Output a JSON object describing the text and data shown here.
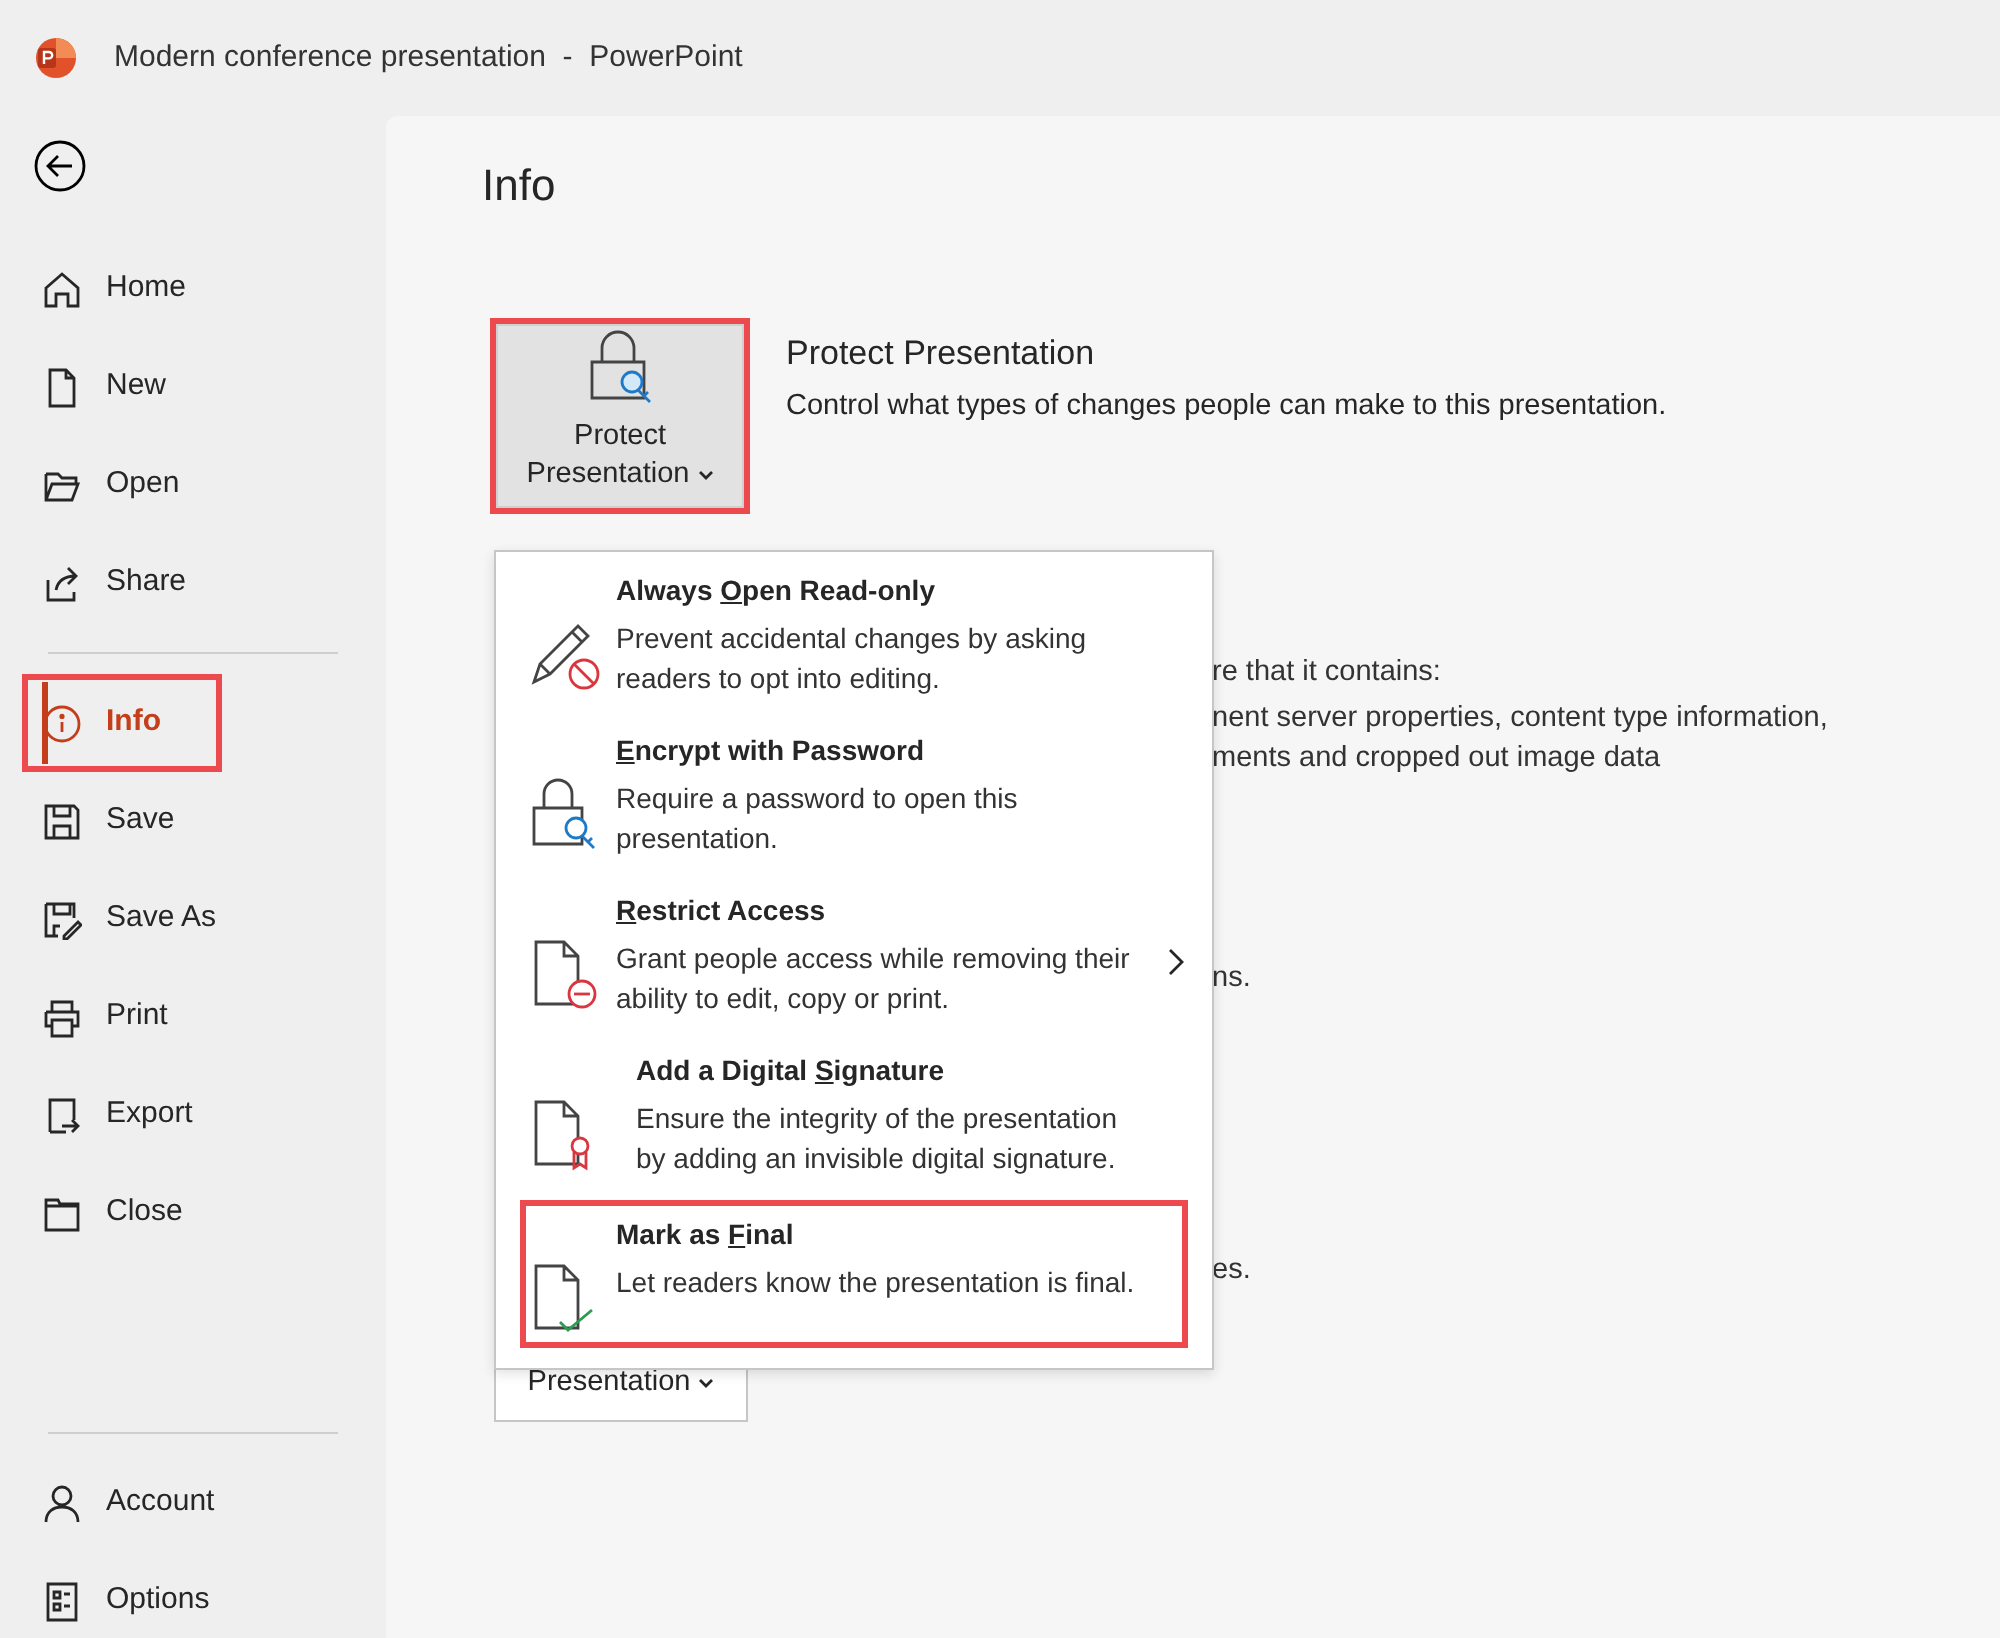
{
  "window": {
    "title": "Modern conference presentation  -  PowerPoint"
  },
  "sidebar": {
    "groups": [
      [
        {
          "label": "Home",
          "selected": false,
          "highlighted": false
        },
        {
          "label": "New",
          "selected": false,
          "highlighted": false
        },
        {
          "label": "Open",
          "selected": false,
          "highlighted": false
        },
        {
          "label": "Share",
          "selected": false,
          "highlighted": false
        }
      ],
      [
        {
          "label": "Info",
          "selected": true,
          "highlighted": true
        },
        {
          "label": "Save",
          "selected": false,
          "highlighted": false
        },
        {
          "label": "Save As",
          "selected": false,
          "highlighted": false
        },
        {
          "label": "Print",
          "selected": false,
          "highlighted": false
        },
        {
          "label": "Export",
          "selected": false,
          "highlighted": false
        },
        {
          "label": "Close",
          "selected": false,
          "highlighted": false
        }
      ],
      [
        {
          "label": "Account",
          "selected": false,
          "highlighted": false
        },
        {
          "label": "Options",
          "selected": false,
          "highlighted": false
        }
      ]
    ]
  },
  "main": {
    "heading": "Info",
    "protect": {
      "button": "Protect Presentation",
      "highlighted": true,
      "expanded": true,
      "title": "Protect Presentation",
      "description": "Control what types of changes people can make to this presentation.",
      "menu": [
        {
          "title": {
            "before": "Always ",
            "key": "O",
            "after": "pen Read-only"
          },
          "description": "Prevent accidental changes by asking readers to opt into editing.",
          "highlighted": false,
          "has_submenu": false
        },
        {
          "title": {
            "key": "E",
            "after": "ncrypt with Password"
          },
          "description": "Require a password to open this presentation.",
          "highlighted": false,
          "has_submenu": false
        },
        {
          "title": {
            "key": "R",
            "after": "estrict Access"
          },
          "description": "Grant people access while removing their ability to edit, copy or print.",
          "highlighted": false,
          "has_submenu": true
        },
        {
          "title": {
            "before": "Add a Digital ",
            "key": "S",
            "after": "ignature"
          },
          "description": "Ensure the integrity of the presentation by adding an invisible digital signature.",
          "highlighted": false,
          "has_submenu": false
        },
        {
          "title": {
            "before": "Mark as ",
            "key": "F",
            "after": "inal"
          },
          "description": "Let readers know the presentation is final.",
          "highlighted": true,
          "has_submenu": false
        }
      ]
    },
    "inspect_fragment": {
      "lead": "re that it contains:",
      "lines": [
        "nent server properties, content type information,",
        "ments and cropped out image data"
      ]
    },
    "fragments": [
      "ns.",
      "es."
    ],
    "second_button": "Presentation"
  }
}
